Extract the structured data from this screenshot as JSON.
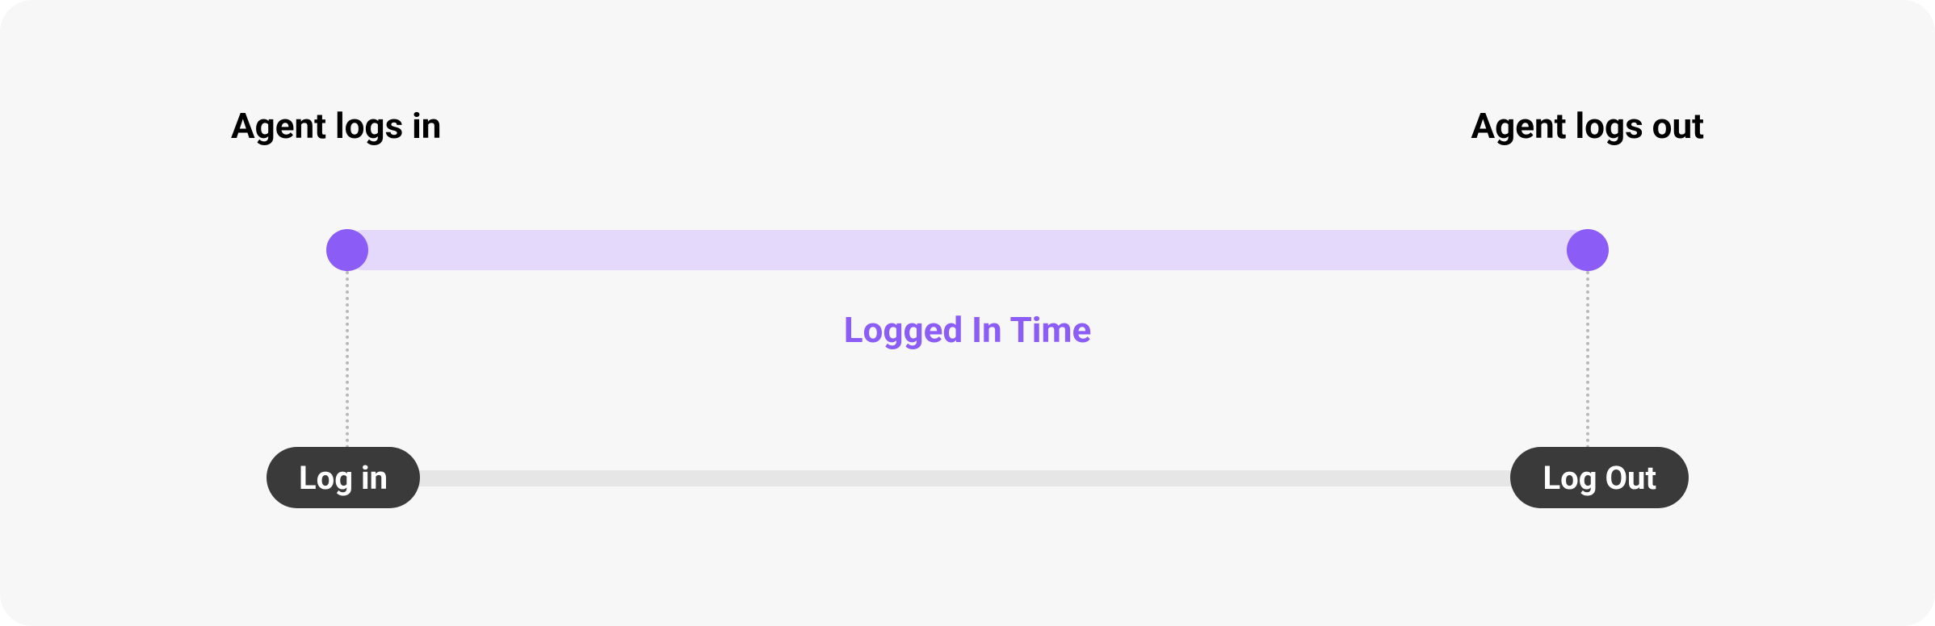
{
  "events": {
    "start_label": "Agent logs in",
    "end_label": "Agent logs out"
  },
  "timeline": {
    "segment_label": "Logged In Time"
  },
  "actions": {
    "start_pill": "Log in",
    "end_pill": "Log Out"
  },
  "colors": {
    "accent": "#8b5cf6",
    "accent_light": "#e4d8fb",
    "pill_bg": "#3a3a3a",
    "canvas_bg": "#f7f7f7",
    "lower_bar": "#e6e6e6",
    "connector": "#b9b9b9"
  }
}
